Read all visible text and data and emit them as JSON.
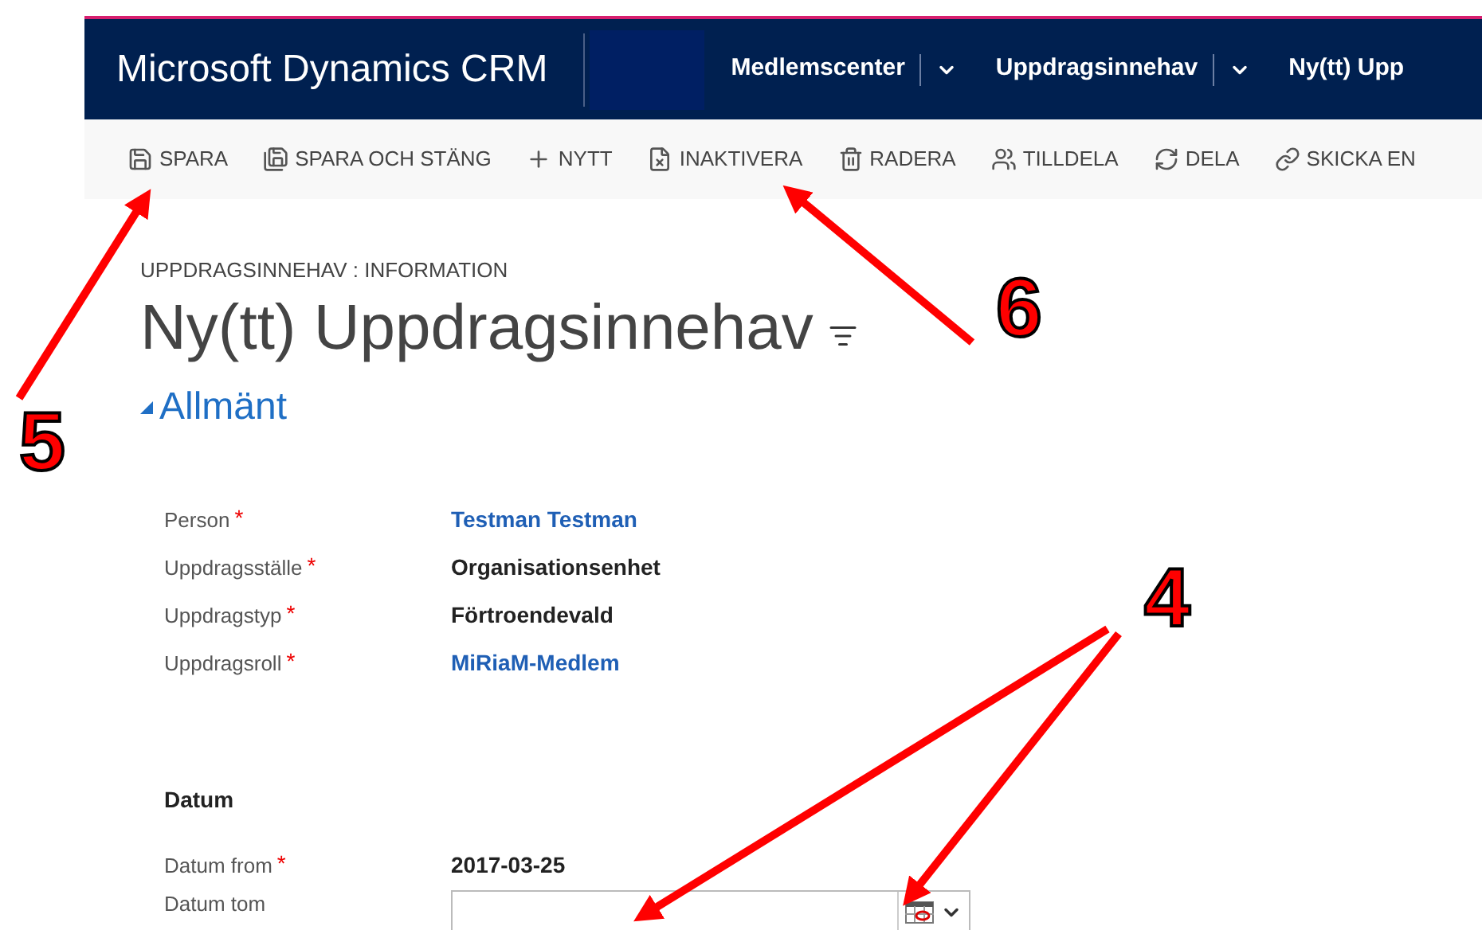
{
  "header": {
    "app_title": "Microsoft Dynamics CRM",
    "nav": [
      {
        "label": "Medlemscenter",
        "dropdown": true
      },
      {
        "label": "Uppdragsinnehav",
        "dropdown": true
      },
      {
        "label": "Ny(tt) Upp",
        "dropdown": false
      }
    ]
  },
  "toolbar": [
    {
      "label": "SPARA"
    },
    {
      "label": "SPARA OCH STÄNG"
    },
    {
      "label": "NYTT"
    },
    {
      "label": "INAKTIVERA"
    },
    {
      "label": "RADERA"
    },
    {
      "label": "TILLDELA"
    },
    {
      "label": "DELA"
    },
    {
      "label": "SKICKA EN"
    }
  ],
  "form": {
    "entity_label": "UPPDRAGSINNEHAV : INFORMATION",
    "title": "Ny(tt) Uppdragsinnehav",
    "section": "Allmänt",
    "fields": [
      {
        "label": "Person",
        "required_mark": "*",
        "kind": "link",
        "value": "Testman Testman"
      },
      {
        "label": "Uppdragsställe",
        "required_mark": "*",
        "kind": "text",
        "value": "Organisationsenhet"
      },
      {
        "label": "Uppdragstyp",
        "required_mark": "*",
        "kind": "text",
        "value": "Förtroendevald"
      },
      {
        "label": "Uppdragsroll",
        "required_mark": "*",
        "kind": "link",
        "value": "MiRiaM-Medlem"
      }
    ],
    "subsection": "Datum",
    "date_fields": [
      {
        "label": "Datum from",
        "required_mark": "*",
        "kind": "text",
        "value": "2017-03-25"
      },
      {
        "label": "Datum tom",
        "kind": "date-input"
      }
    ]
  },
  "annotations": [
    {
      "label": "5"
    },
    {
      "label": "6"
    },
    {
      "label": "4"
    }
  ]
}
